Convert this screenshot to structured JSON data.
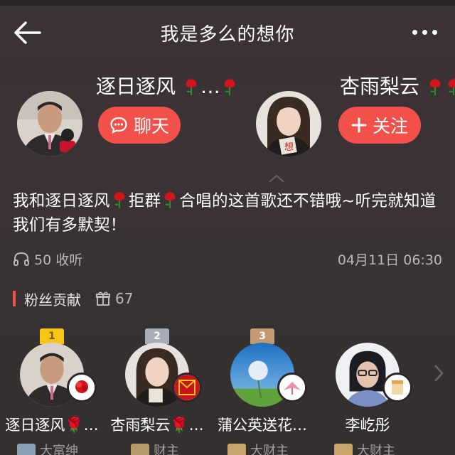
{
  "header": {
    "title": "我是多么的想你",
    "back_icon": "back-arrow-icon",
    "more_icon": "more-icon"
  },
  "singers": [
    {
      "name": "逐日逐风",
      "suffix": "…",
      "button_label": "聊天",
      "button_icon": "chat-bubble-icon"
    },
    {
      "name": "杏雨梨云",
      "suffix": "",
      "button_label": "关注",
      "button_icon": "plus-icon"
    }
  ],
  "message": {
    "parts": [
      "我和逐日逐风",
      "拒群",
      "合唱的这首歌还不错哦~听完就知道我们有多默契！"
    ]
  },
  "meta": {
    "listen_count": "50 收听",
    "date": "04月11日 06:30"
  },
  "fan_section": {
    "label": "粉丝贡献",
    "gift_count": "67"
  },
  "fans": [
    {
      "rank": "1",
      "name": "逐日逐风🌹…",
      "title": "大富绅",
      "rank_color": "#f5c518"
    },
    {
      "rank": "2",
      "name": "杏雨梨云🌹…",
      "title": "财主",
      "rank_color": "#a7adb8"
    },
    {
      "rank": "3",
      "name": "蒲公英送花…",
      "title": "大财主",
      "rank_color": "#c59a72"
    },
    {
      "rank": "",
      "name": "李屹彤",
      "title": "大财主",
      "rank_color": ""
    }
  ],
  "colors": {
    "accent": "#f2504b",
    "background": "#3a3234",
    "secondary_text": "#bdb8b8"
  }
}
